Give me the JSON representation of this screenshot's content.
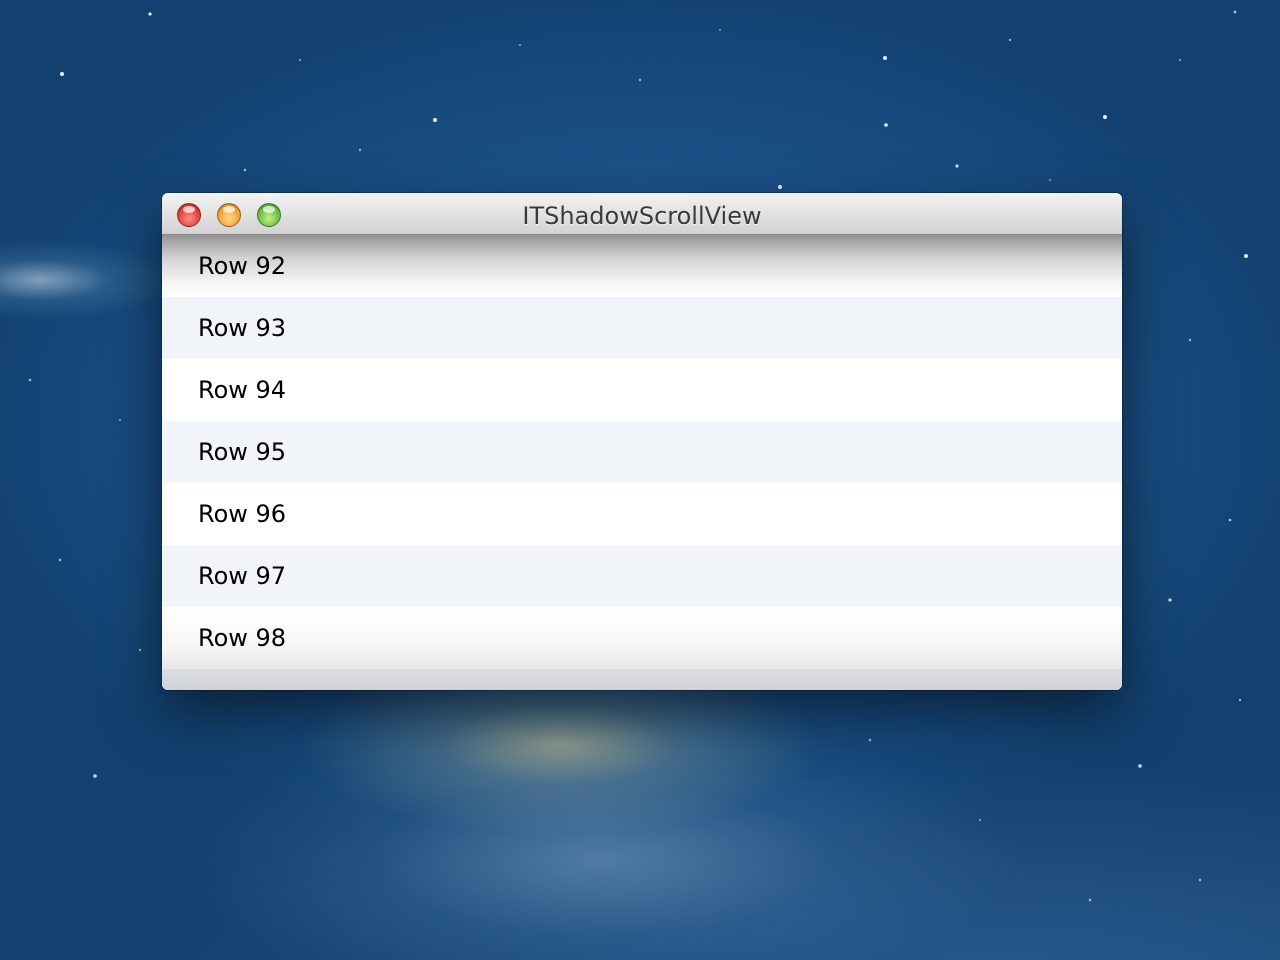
{
  "window": {
    "title": "ITShadowScrollView",
    "controls": {
      "close_icon": "close-traffic-light-icon",
      "minimize_icon": "minimize-traffic-light-icon",
      "zoom_icon": "zoom-traffic-light-icon"
    }
  },
  "table": {
    "rows": [
      "Row 92",
      "Row 93",
      "Row 94",
      "Row 95",
      "Row 96",
      "Row 97",
      "Row 98"
    ]
  },
  "colors": {
    "close": "#e2463f",
    "minimize": "#f0a63a",
    "zoom": "#6fc048",
    "alternate_row": "#f1f4f9"
  }
}
